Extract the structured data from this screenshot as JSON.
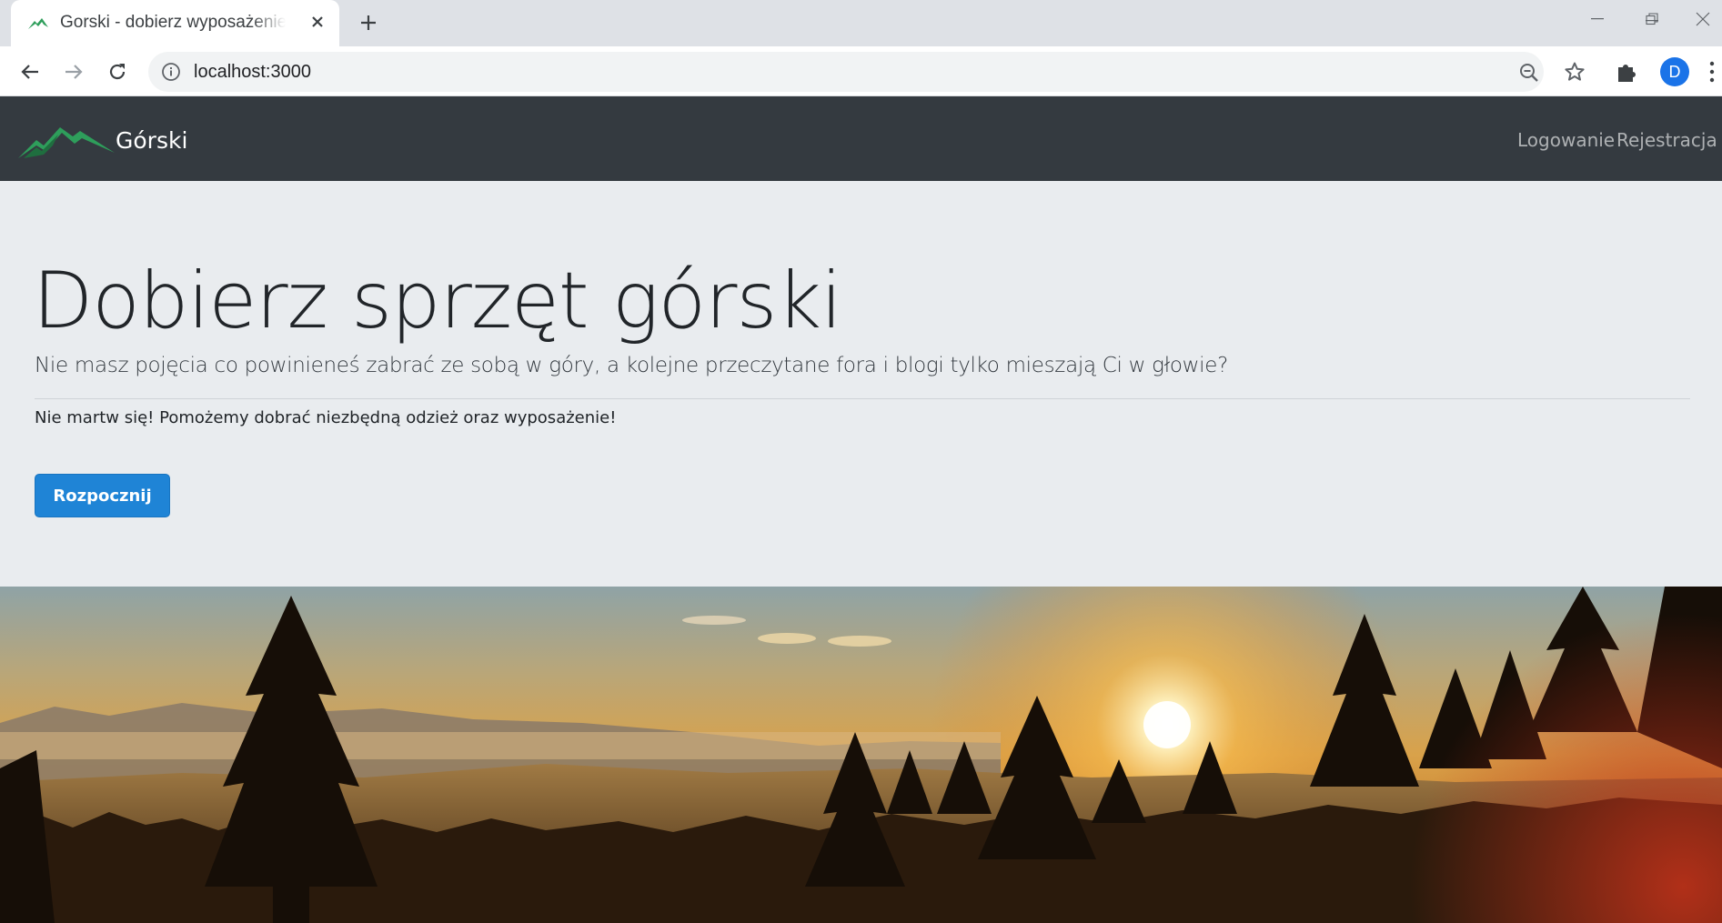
{
  "browser": {
    "tab_title": "Gorski - dobierz wyposażenie w góry",
    "url": "localhost:3000",
    "profile_initial": "D"
  },
  "navbar": {
    "brand": "Górski",
    "links": [
      "Logowanie",
      "Rejestracja"
    ]
  },
  "jumbotron": {
    "heading": "Dobierz sprzęt górski",
    "lead": "Nie masz pojęcia co powinieneś zabrać ze sobą w góry, a kolejne przeczytane fora i blogi tylko mieszają Ci w głowie?",
    "text": "Nie martw się! Pomożemy dobrać niezbędną odzież oraz wyposażenie!",
    "button": "Rozpocznij"
  },
  "colors": {
    "navbar_bg": "#343a40",
    "jumbotron_bg": "#e9ecef",
    "primary": "#1f84d6",
    "brand_green": "#2e9e5b"
  },
  "hero_image": {
    "icon": "mountain-sunset-photo"
  }
}
